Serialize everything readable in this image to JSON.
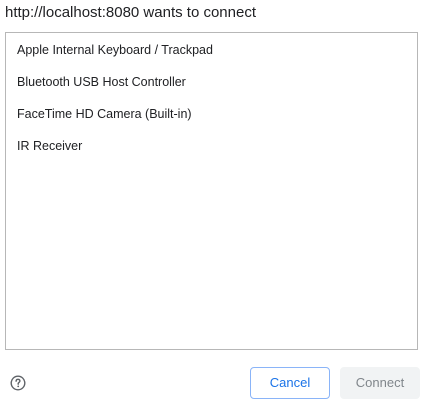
{
  "dialog": {
    "title": "http://localhost:8080 wants to connect"
  },
  "devices": [
    {
      "label": "Apple Internal Keyboard / Trackpad"
    },
    {
      "label": "Bluetooth USB Host Controller"
    },
    {
      "label": "FaceTime HD Camera (Built-in)"
    },
    {
      "label": "IR Receiver"
    }
  ],
  "footer": {
    "help_icon": "help-circle-icon",
    "cancel_label": "Cancel",
    "connect_label": "Connect"
  },
  "colors": {
    "accent": "#1a73e8",
    "disabled_text": "#80868b",
    "disabled_bg": "#f1f3f4"
  }
}
